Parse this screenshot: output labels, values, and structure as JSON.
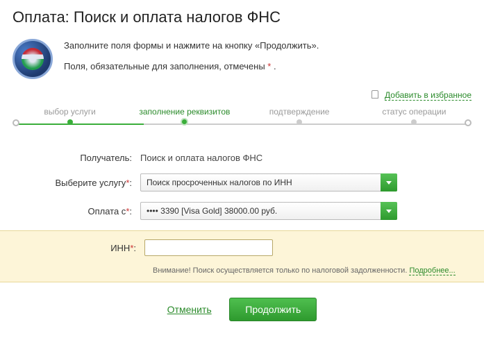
{
  "title": "Оплата: Поиск и оплата налогов ФНС",
  "intro": {
    "line1": "Заполните поля формы и нажмите на кнопку «Продолжить».",
    "line2_prefix": "Поля, обязательные для заполнения, отмечены ",
    "asterisk": "*",
    "line2_suffix": " ."
  },
  "favorite": {
    "label": "Добавить в избранное"
  },
  "steps": {
    "s1": "выбор услуги",
    "s2": "заполнение реквизитов",
    "s3": "подтверждение",
    "s4": "статус операции"
  },
  "form": {
    "recipient_label": "Получатель:",
    "recipient_value": "Поиск и оплата налогов ФНС",
    "service_label": "Выберите услугу",
    "service_value": "Поиск просроченных налогов по ИНН",
    "payfrom_label": "Оплата с",
    "payfrom_value": "•••• 3390 [Visa Gold] 38000.00 руб.",
    "inn_label": "ИНН",
    "inn_value": ""
  },
  "hint": {
    "text": "Внимание! Поиск осуществляется только по налоговой задолженности. ",
    "link": "Подробнее..."
  },
  "actions": {
    "cancel": "Отменить",
    "continue": "Продолжить"
  },
  "colors": {
    "accent": "#2e9a2e"
  }
}
